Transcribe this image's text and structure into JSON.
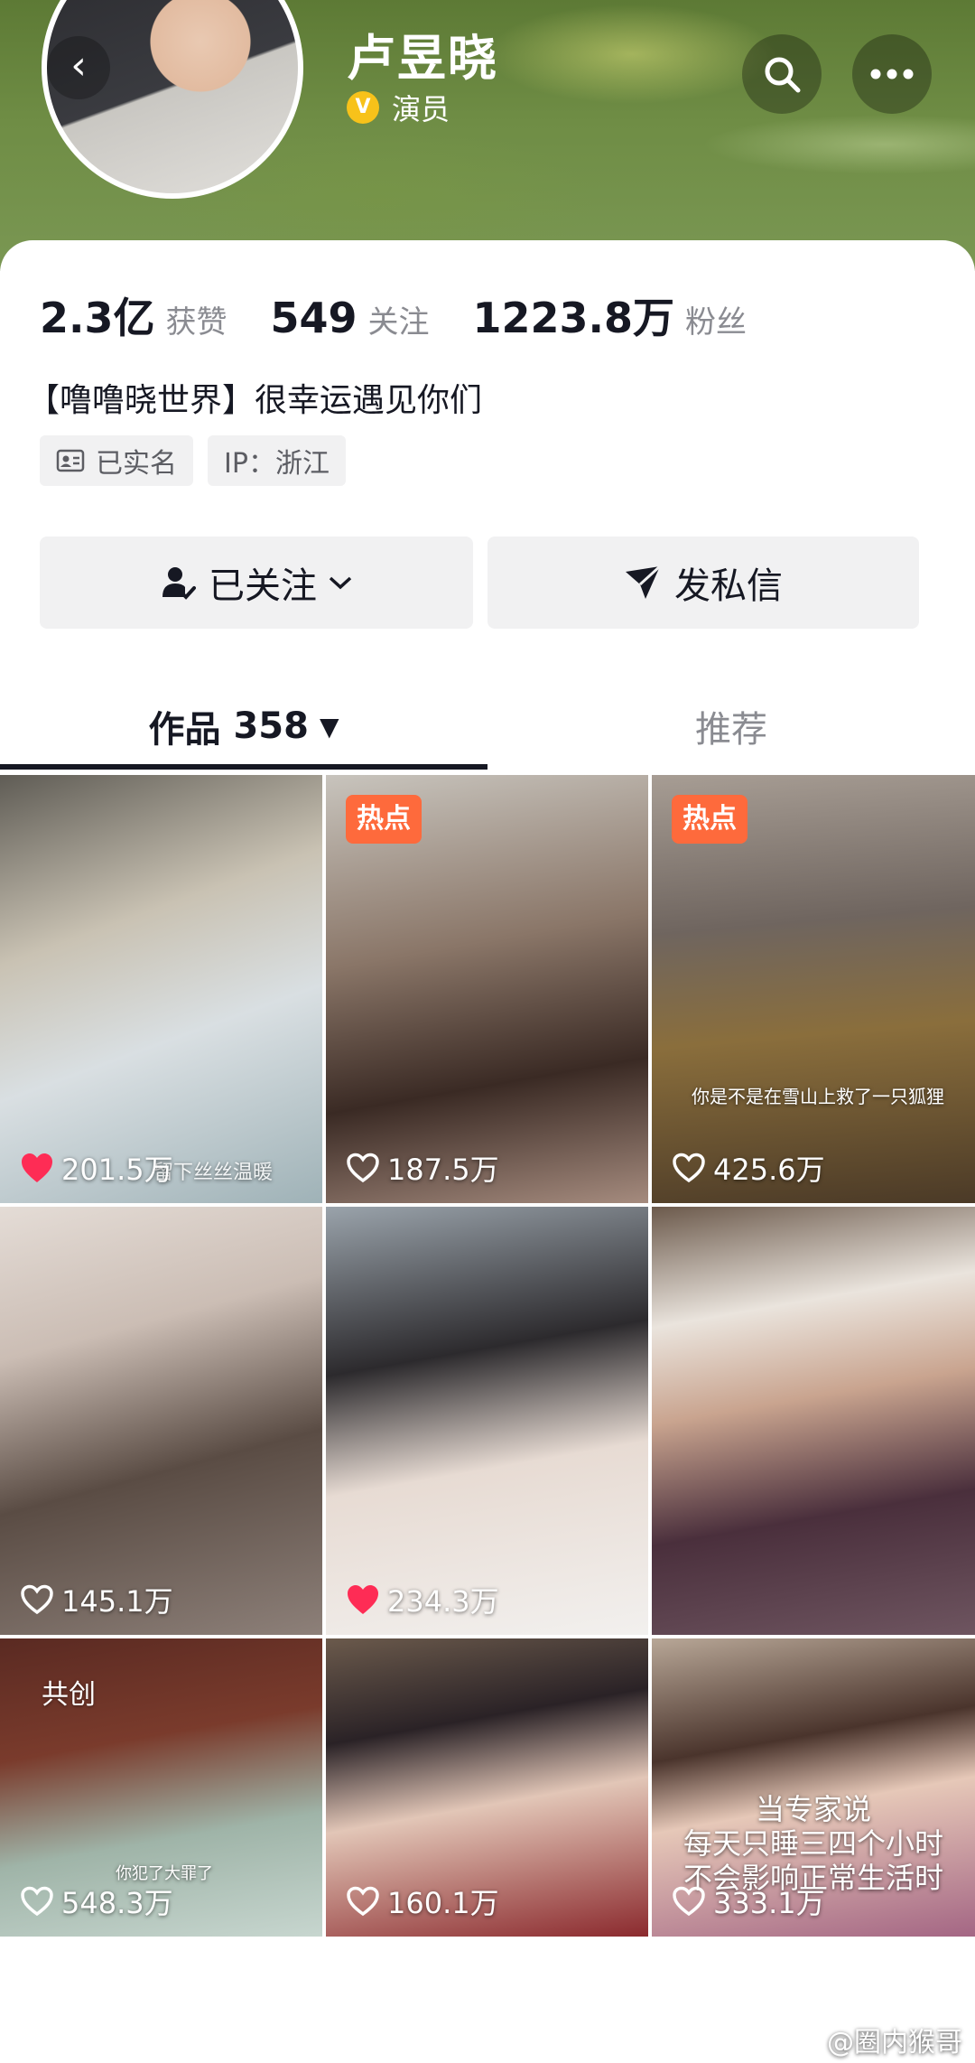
{
  "header": {
    "name": "卢昱晓",
    "verify_badge": "V",
    "verify_text": "演员"
  },
  "stats": [
    {
      "value": "2.3亿",
      "label": "获赞"
    },
    {
      "value": "549",
      "label": "关注"
    },
    {
      "value": "1223.8万",
      "label": "粉丝"
    }
  ],
  "bio": "【噜噜晓世界】很幸运遇见你们",
  "tags": {
    "real_name": "已实名",
    "ip": "IP：浙江"
  },
  "actions": {
    "follow_label": "已关注",
    "message_label": "发私信"
  },
  "tabs": {
    "works_label": "作品",
    "works_count": "358",
    "recommend_label": "推荐"
  },
  "videos": [
    {
      "likes": "201.5万",
      "liked": true,
      "badge": "",
      "caption": "留下丝丝温暖"
    },
    {
      "likes": "187.5万",
      "liked": false,
      "badge": "热点",
      "caption": ""
    },
    {
      "likes": "425.6万",
      "liked": false,
      "badge": "热点",
      "caption": "你是不是在雪山上救了一只狐狸"
    },
    {
      "likes": "145.1万",
      "liked": false,
      "badge": "",
      "caption": ""
    },
    {
      "likes": "234.3万",
      "liked": true,
      "badge": "",
      "caption": ""
    },
    {
      "likes": "",
      "liked": false,
      "badge": "",
      "caption": ""
    },
    {
      "likes": "548.3万",
      "liked": false,
      "badge": "共创",
      "caption": "你犯了大罪了"
    },
    {
      "likes": "160.1万",
      "liked": false,
      "badge": "",
      "caption": ""
    },
    {
      "likes": "333.1万",
      "liked": false,
      "badge": "",
      "caption": "当专家说\n每天只睡三四个小时\n不会影响正常生活时"
    }
  ],
  "watermark": "@圈内猴哥",
  "colors": {
    "hot_badge": "#fe6a3c",
    "liked_heart": "#fe2c55",
    "verify": "#f7c21a",
    "muted_text": "#8a8b91",
    "button_bg": "#f1f1f2"
  }
}
